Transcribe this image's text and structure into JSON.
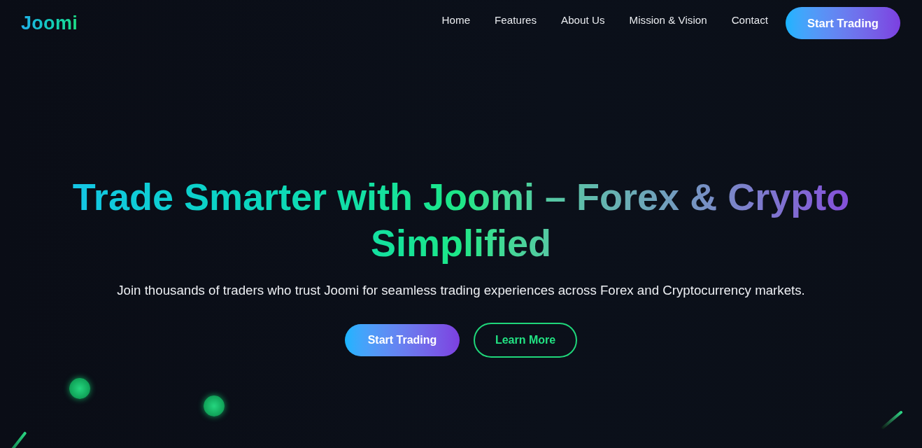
{
  "header": {
    "logo": "Joomi",
    "nav": [
      {
        "label": "Home"
      },
      {
        "label": "Features"
      },
      {
        "label": "About Us"
      },
      {
        "label": "Mission & Vision"
      },
      {
        "label": "Contact"
      }
    ],
    "cta": "Start Trading"
  },
  "hero": {
    "title": "Trade Smarter with Joomi – Forex & Crypto Simplified",
    "subtitle": "Join thousands of traders who trust Joomi for seamless trading experiences across Forex and Cryptocurrency markets.",
    "buttons": [
      {
        "label": "Start Trading",
        "kind": "primary"
      },
      {
        "label": "Learn More",
        "kind": "outline"
      }
    ]
  }
}
